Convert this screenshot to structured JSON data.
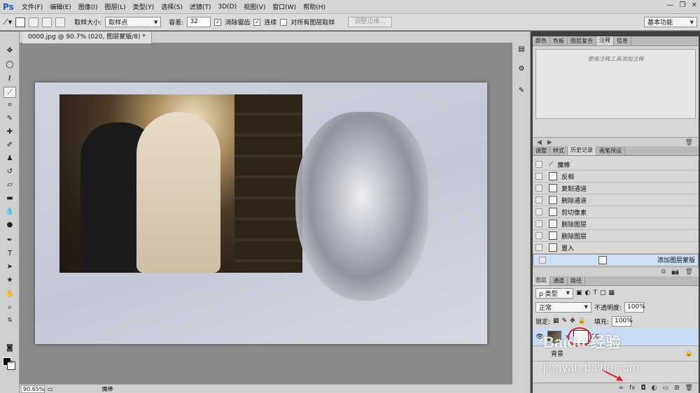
{
  "app": {
    "logo": "Ps"
  },
  "menu": [
    "文件(F)",
    "编辑(E)",
    "图像(I)",
    "图层(L)",
    "类型(Y)",
    "选择(S)",
    "滤镜(T)",
    "3D(D)",
    "视图(V)",
    "窗口(W)",
    "帮助(H)"
  ],
  "window_controls": {
    "minimize": "—",
    "restore": "❐",
    "close": "✕"
  },
  "options": {
    "sample_size_label": "取样大小:",
    "sample_size_value": "取样点",
    "tolerance_label": "容差:",
    "tolerance_value": "32",
    "antialias_label": "消除锯齿",
    "contiguous_label": "连续",
    "sample_all_label": "对所有图层取样",
    "refine_edge_label": "调整边缘...",
    "workspace_value": "基本功能"
  },
  "document": {
    "tab_title": "0000.jpg @ 90.7% (020, 图层蒙版/8) *"
  },
  "status": {
    "zoom": "90.65%",
    "info": "魔棒"
  },
  "panels": {
    "notes_tabs": [
      "颜色",
      "色板",
      "图层复合",
      "注释",
      "信息"
    ],
    "notes_active": "注释",
    "notes_empty": "使用注释工具添加注释",
    "history_tabs": [
      "调整",
      "样式",
      "历史记录",
      "画笔预设"
    ],
    "history_active": "历史记录",
    "history_items": [
      "魔棒",
      "反相",
      "复制通道",
      "删除通道",
      "剪切像素",
      "删除图层",
      "删除图层",
      "置入",
      "添加图层蒙版"
    ],
    "layers_tabs": [
      "图层",
      "通道",
      "路径"
    ],
    "layers_active": "图层",
    "filter_label": "ρ 类型",
    "blend_mode": "正常",
    "opacity_label": "不透明度:",
    "opacity_value": "100%",
    "lock_label": "锁定:",
    "fill_label": "填充:",
    "fill_value": "100%",
    "layer_name": "20",
    "bg_layer_name": "背景"
  },
  "watermark": {
    "line1": "Baidu 经验",
    "line2": "jingyan.baidu.com"
  },
  "colors": {
    "selection_highlight": "#cde0f5",
    "annotation_red": "#e02020"
  }
}
